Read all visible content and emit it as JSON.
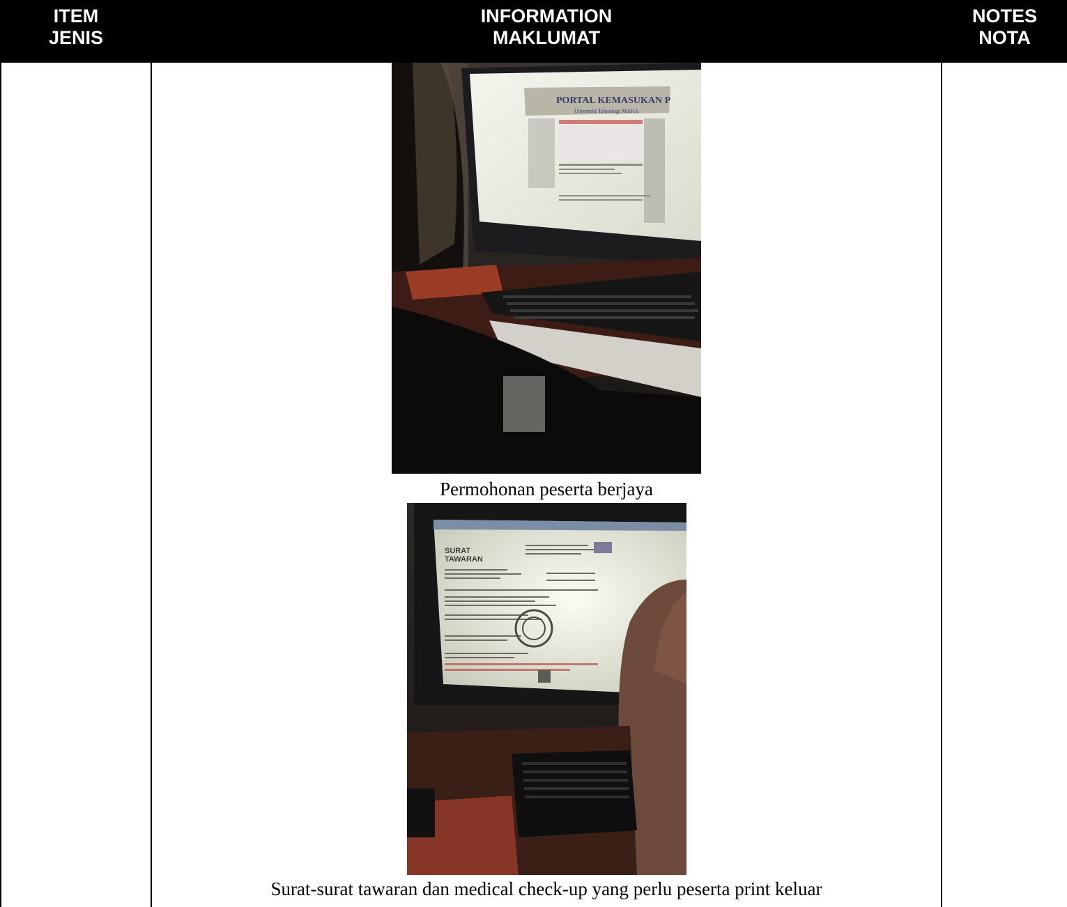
{
  "table": {
    "header": {
      "col1": {
        "en": "ITEM",
        "ms": "JENIS"
      },
      "col2": {
        "en": "INFORMATION",
        "ms": "MAKLUMAT"
      },
      "col3": {
        "en": "NOTES",
        "ms": "NOTA"
      }
    },
    "row": {
      "item": "",
      "notes": "",
      "figures": [
        {
          "caption": "Permohonan peserta berjaya",
          "photo": "person-at-computer-portal-photo"
        },
        {
          "caption": "Surat-surat tawaran dan medical check-up yang perlu peserta print keluar",
          "photo": "offer-letter-on-monitor-photo"
        }
      ]
    }
  },
  "colors": {
    "header_bg": "#000000",
    "header_text": "#ffffff",
    "border": "#000000"
  }
}
